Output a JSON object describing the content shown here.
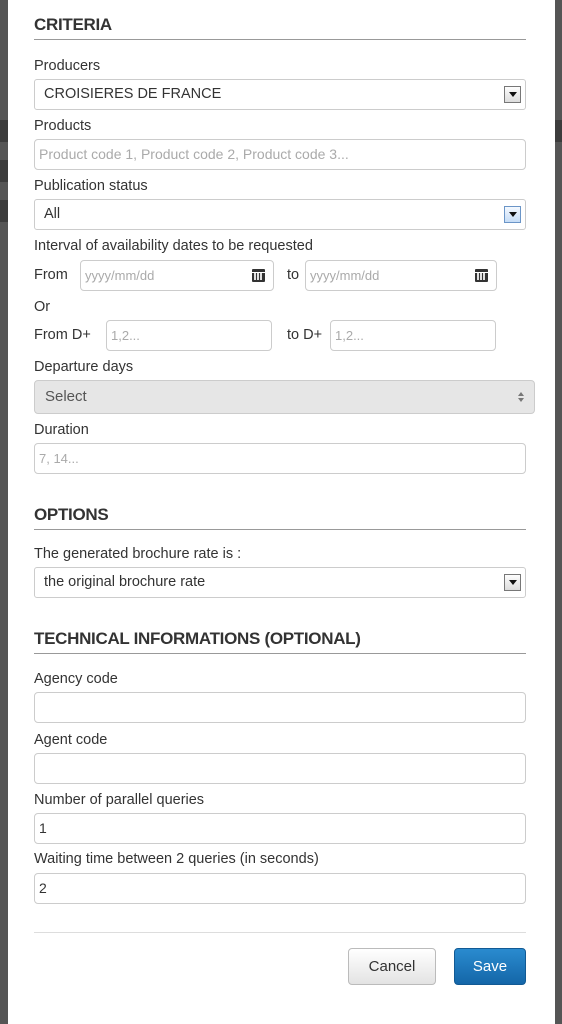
{
  "criteria": {
    "title": "CRITERIA",
    "producers_label": "Producers",
    "producers_value": "CROISIERES DE FRANCE",
    "products_label": "Products",
    "products_placeholder": "Product code 1, Product code 2, Product code 3...",
    "publication_label": "Publication status",
    "publication_value": "All",
    "interval_label": "Interval of availability dates to be requested",
    "from_label": "From",
    "date_placeholder": "yyyy/mm/dd",
    "to_label": "to",
    "or_label": "Or",
    "from_d_label": "From D+",
    "d_placeholder": "1,2...",
    "to_d_label": "to D+",
    "departure_label": "Departure days",
    "departure_value": "Select",
    "duration_label": "Duration",
    "duration_placeholder": "7, 14..."
  },
  "options": {
    "title": "OPTIONS",
    "rate_label": "The generated brochure rate is :",
    "rate_value": "the original brochure rate"
  },
  "technical": {
    "title": "TECHNICAL INFORMATIONS (OPTIONAL)",
    "agency_label": "Agency code",
    "agency_value": "",
    "agent_label": "Agent code",
    "agent_value": "",
    "parallel_label": "Number of parallel queries",
    "parallel_value": "1",
    "waiting_label": "Waiting time between 2 queries (in seconds)",
    "waiting_value": "2"
  },
  "footer": {
    "cancel_label": "Cancel",
    "save_label": "Save"
  },
  "colors": {
    "save_button": "#1a74b8",
    "backdrop": "#4a4a4a"
  }
}
